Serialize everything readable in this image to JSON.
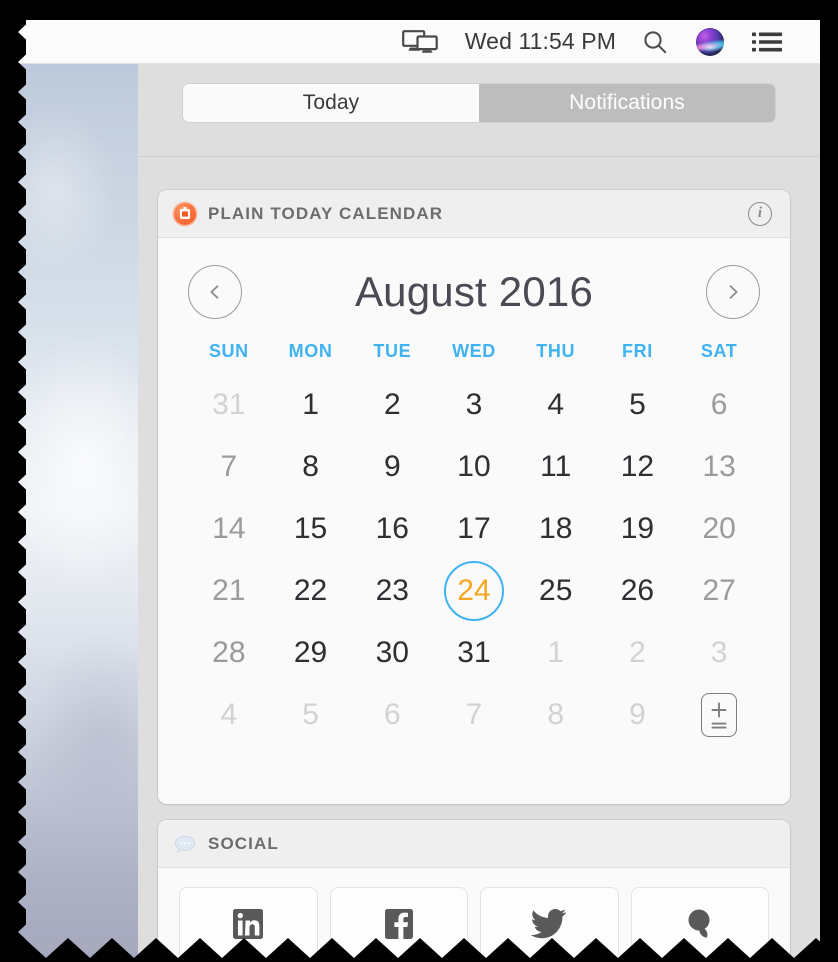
{
  "menubar": {
    "clock": "Wed 11:54 PM",
    "icons": [
      {
        "name": "airplay-display-icon",
        "label": "Display Mirroring"
      },
      {
        "name": "search-icon",
        "label": "Spotlight Search"
      },
      {
        "name": "siri-icon",
        "label": "Siri"
      },
      {
        "name": "notification-center-icon",
        "label": "Notification Center"
      }
    ]
  },
  "tabs": {
    "today_label": "Today",
    "notifications_label": "Notifications",
    "selected": "Today"
  },
  "widgets": {
    "calendar": {
      "title": "PLAIN TODAY CALENDAR",
      "icon": "calendar-widget-icon",
      "info_label": "i",
      "month_label": "August 2016",
      "prev_label": "Previous month",
      "next_label": "Next month",
      "weekdays": [
        "SUN",
        "MON",
        "TUE",
        "WED",
        "THU",
        "FRI",
        "SAT"
      ],
      "weeks": [
        [
          {
            "n": "31",
            "type": "other"
          },
          {
            "n": "1",
            "type": "current"
          },
          {
            "n": "2",
            "type": "current"
          },
          {
            "n": "3",
            "type": "current"
          },
          {
            "n": "4",
            "type": "current"
          },
          {
            "n": "5",
            "type": "current"
          },
          {
            "n": "6",
            "type": "weekend"
          }
        ],
        [
          {
            "n": "7",
            "type": "weekend"
          },
          {
            "n": "8",
            "type": "current"
          },
          {
            "n": "9",
            "type": "current"
          },
          {
            "n": "10",
            "type": "current"
          },
          {
            "n": "11",
            "type": "current"
          },
          {
            "n": "12",
            "type": "current"
          },
          {
            "n": "13",
            "type": "weekend"
          }
        ],
        [
          {
            "n": "14",
            "type": "weekend"
          },
          {
            "n": "15",
            "type": "current"
          },
          {
            "n": "16",
            "type": "current"
          },
          {
            "n": "17",
            "type": "current"
          },
          {
            "n": "18",
            "type": "current"
          },
          {
            "n": "19",
            "type": "current"
          },
          {
            "n": "20",
            "type": "weekend"
          }
        ],
        [
          {
            "n": "21",
            "type": "weekend"
          },
          {
            "n": "22",
            "type": "current"
          },
          {
            "n": "23",
            "type": "current"
          },
          {
            "n": "24",
            "type": "today"
          },
          {
            "n": "25",
            "type": "current"
          },
          {
            "n": "26",
            "type": "current"
          },
          {
            "n": "27",
            "type": "weekend"
          }
        ],
        [
          {
            "n": "28",
            "type": "weekend"
          },
          {
            "n": "29",
            "type": "current"
          },
          {
            "n": "30",
            "type": "current"
          },
          {
            "n": "31",
            "type": "current"
          },
          {
            "n": "1",
            "type": "other"
          },
          {
            "n": "2",
            "type": "other"
          },
          {
            "n": "3",
            "type": "other"
          }
        ],
        [
          {
            "n": "4",
            "type": "other"
          },
          {
            "n": "5",
            "type": "other"
          },
          {
            "n": "6",
            "type": "other"
          },
          {
            "n": "7",
            "type": "other"
          },
          {
            "n": "8",
            "type": "other"
          },
          {
            "n": "9",
            "type": "other"
          },
          {
            "n": "",
            "type": "button",
            "button": "add-subtract-button"
          }
        ]
      ],
      "today_number": "24"
    },
    "social": {
      "title": "SOCIAL",
      "icon": "social-bubble-icon",
      "buttons": [
        {
          "name": "linkedin-button",
          "label": "LinkedIn"
        },
        {
          "name": "facebook-button",
          "label": "Facebook"
        },
        {
          "name": "twitter-button",
          "label": "Twitter"
        },
        {
          "name": "vimeo-button",
          "label": "Vimeo"
        }
      ]
    }
  },
  "colors": {
    "accent_blue": "#3fb3f2",
    "today_orange": "#f6a623",
    "widget_icon_orange": "#f05a22",
    "panel_gray": "#dedede",
    "card_bg": "#fafafa"
  }
}
